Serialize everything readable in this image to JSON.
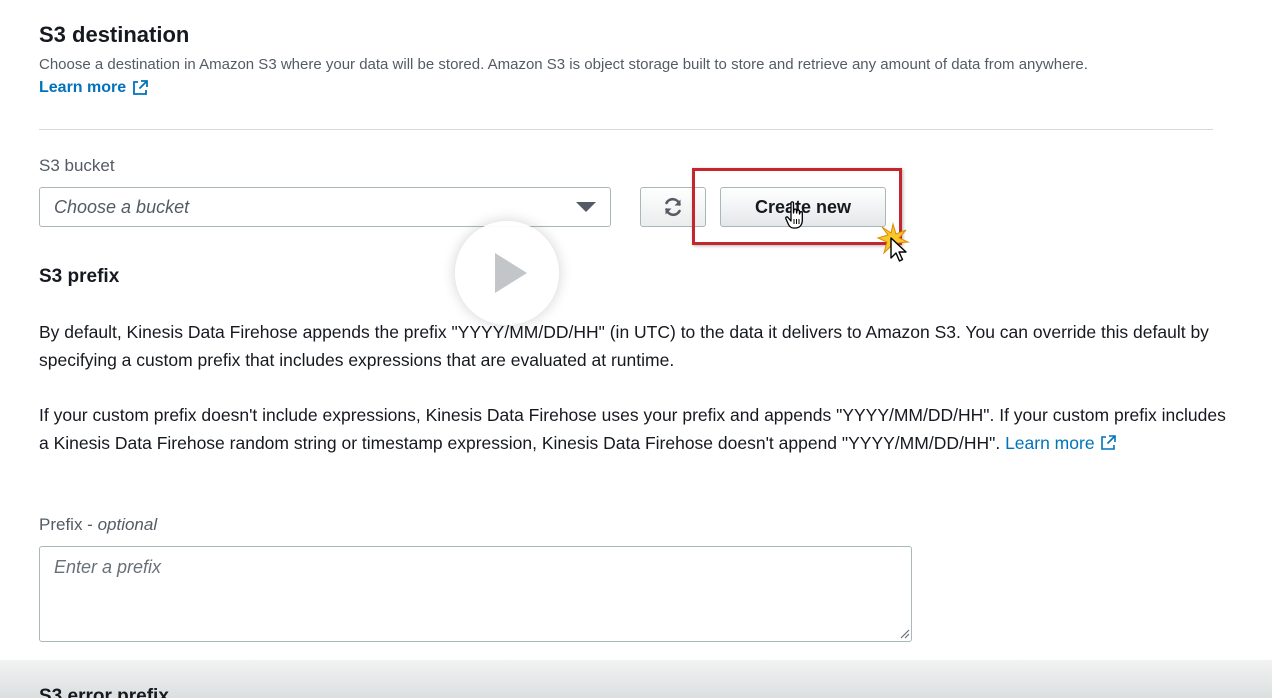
{
  "section": {
    "title": "S3 destination",
    "description": "Choose a destination in Amazon S3 where your data will be stored. Amazon S3 is object storage built to store and retrieve any amount of data from anywhere.",
    "learn_more": "Learn more"
  },
  "bucket": {
    "label": "S3 bucket",
    "placeholder": "Choose a bucket",
    "create_button": "Create new"
  },
  "prefix_section": {
    "heading": "S3 prefix",
    "paragraph1": "By default, Kinesis Data Firehose appends the prefix \"YYYY/MM/DD/HH\" (in UTC) to the data it delivers to Amazon S3. You can override this default by specifying a custom prefix that includes expressions that are evaluated at runtime.",
    "paragraph2": "If your custom prefix doesn't include expressions, Kinesis Data Firehose uses your prefix and appends \"YYYY/MM/DD/HH\". If your custom prefix includes a Kinesis Data Firehose random string or timestamp expression, Kinesis Data Firehose doesn't append \"YYYY/MM/DD/HH\".",
    "learn_more": "Learn more",
    "field_label": "Prefix - ",
    "field_optional": "optional",
    "placeholder": "Enter a prefix",
    "value": ""
  },
  "next_section": {
    "heading": "S3 error prefix"
  },
  "colors": {
    "link": "#0073bb",
    "highlight": "#c4262e",
    "text": "#16191f",
    "muted": "#545b64"
  },
  "icons": {
    "external_link": "external-link-icon",
    "refresh": "refresh-icon",
    "dropdown": "caret-down-icon",
    "play": "play-icon"
  }
}
